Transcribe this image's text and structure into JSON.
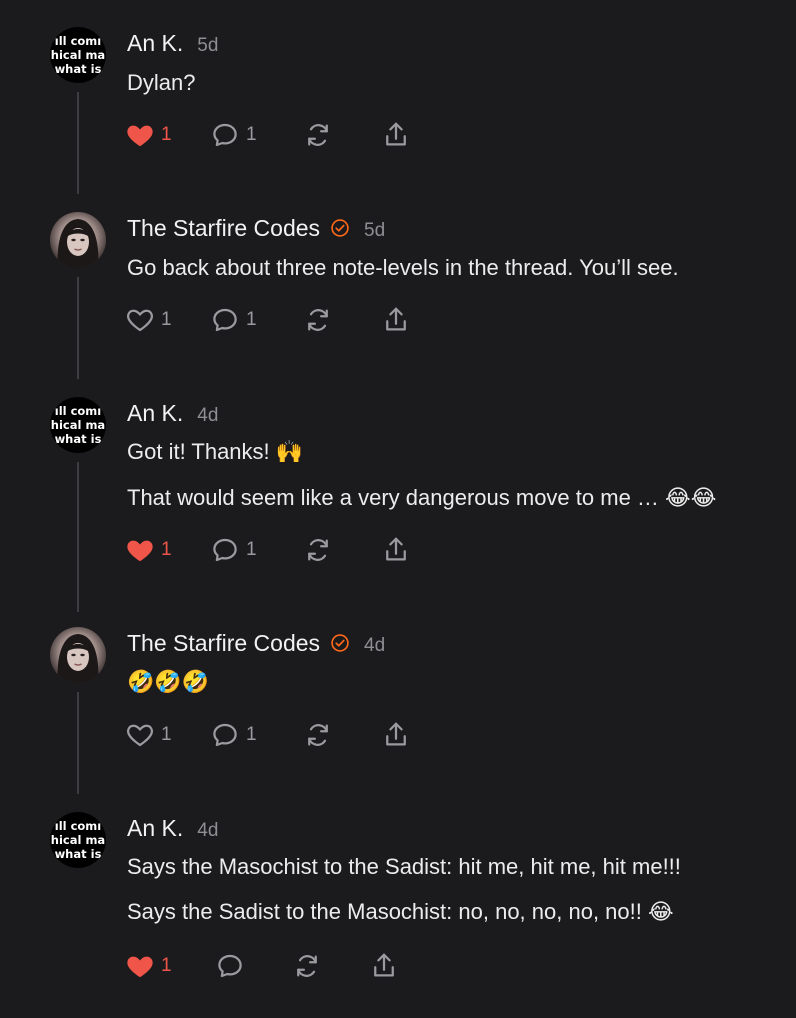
{
  "colors": {
    "background": "#1b1b1d",
    "accent": "#f0554a",
    "verified": "#ff6719",
    "muted": "#8e8e93"
  },
  "notes": [
    {
      "author": "An K.",
      "time": "5d",
      "avatar_lines": [
        "ıll comı",
        "hical ma",
        "what is"
      ],
      "lines": [
        "Dylan?"
      ],
      "liked": true,
      "likes": "1",
      "comments": "1"
    },
    {
      "author": "The Starfire Codes",
      "time": "5d",
      "verified": true,
      "lines": [
        "Go back about three note-levels in the thread. You’ll see."
      ],
      "liked": false,
      "likes": "1",
      "comments": "1"
    },
    {
      "author": "An K.",
      "time": "4d",
      "avatar_lines": [
        "ıll comı",
        "hical ma",
        "what is"
      ],
      "lines": [
        "Got it! Thanks! 🙌",
        "That would seem like a very dangerous move to me … 😂😂"
      ],
      "liked": true,
      "likes": "1",
      "comments": "1"
    },
    {
      "author": "The Starfire Codes",
      "time": "4d",
      "verified": true,
      "lines": [
        "🤣🤣🤣"
      ],
      "liked": false,
      "likes": "1",
      "comments": "1"
    },
    {
      "author": "An K.",
      "time": "4d",
      "avatar_lines": [
        "ıll comı",
        "hical ma",
        "what is"
      ],
      "lines": [
        "Says the Masochist to the Sadist: hit me, hit me, hit me!!!",
        "Says the Sadist to the Masochist: no, no, no, no, no!! 😂"
      ],
      "liked": true,
      "likes": "1",
      "comments": ""
    }
  ],
  "icons": {
    "like": "heart-icon",
    "comment": "comment-bubble-icon",
    "restack": "restack-icon",
    "share": "share-icon",
    "verified": "verified-check-icon"
  }
}
